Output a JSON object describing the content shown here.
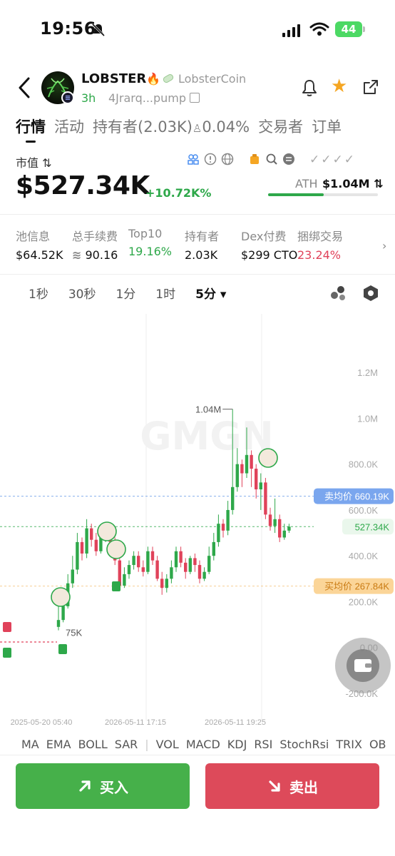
{
  "status_bar": {
    "time": "19:56",
    "battery": "44"
  },
  "token": {
    "name": "LOBSTER",
    "full_name": "LobsterCoin",
    "age": "3h",
    "address": "4Jrarq...pump"
  },
  "tabs": [
    "行情",
    "活动",
    "持有者(2.03K)",
    "0.04%",
    "交易者",
    "订单"
  ],
  "market_cap": {
    "label": "市值 ⇅",
    "value": "$527.34K",
    "change": "+10.72K%",
    "ath_label": "ATH",
    "ath_value": "$1.04M ⇅",
    "ath_progress": 0.507
  },
  "stats": [
    {
      "label": "池信息",
      "value": "$64.52K",
      "tone": "normal"
    },
    {
      "label": "总手续费",
      "value": "90.16",
      "tone": "normal"
    },
    {
      "label": "Top10",
      "value": "19.16%",
      "tone": "green"
    },
    {
      "label": "持有者",
      "value": "2.03K",
      "tone": "normal"
    },
    {
      "label": "Dex付费",
      "value": "$299 CTO",
      "tone": "normal"
    },
    {
      "label": "捆绑交易",
      "value": "23.24%",
      "tone": "red"
    }
  ],
  "intervals": [
    "1秒",
    "30秒",
    "1分",
    "1时",
    "5分 ▾"
  ],
  "chart_data": {
    "type": "candlestick",
    "y_ticks": [
      "1.2M",
      "1.0M",
      "800.0K",
      "600.0K",
      "400.0K",
      "200.0K",
      "0.00",
      "-200.0K"
    ],
    "x_labels": [
      "2025-05-20 05:40",
      "2026-05-11 17:15",
      "2026-05-11 19:25"
    ],
    "ylim": [
      -200000,
      1300000
    ],
    "price_labels": {
      "sell_avg": "卖均价 660.19K",
      "current": "527.34K",
      "buy_avg": "买均价 267.84K",
      "high_annotation": "1.04M",
      "low_annotation": "75K"
    },
    "sell_avg": 660190,
    "current": 527340,
    "buy_avg": 267840,
    "candles": [
      [
        90000,
        120000,
        210000,
        75000
      ],
      [
        120000,
        180000,
        230000,
        110000
      ],
      [
        180000,
        280000,
        320000,
        170000
      ],
      [
        280000,
        340000,
        400000,
        260000
      ],
      [
        340000,
        460000,
        500000,
        320000
      ],
      [
        460000,
        410000,
        480000,
        380000
      ],
      [
        410000,
        520000,
        560000,
        390000
      ],
      [
        520000,
        470000,
        540000,
        440000
      ],
      [
        470000,
        420000,
        500000,
        400000
      ],
      [
        420000,
        480000,
        520000,
        410000
      ],
      [
        480000,
        520000,
        540000,
        460000
      ],
      [
        520000,
        460000,
        530000,
        440000
      ],
      [
        460000,
        380000,
        480000,
        360000
      ],
      [
        380000,
        270000,
        420000,
        250000
      ],
      [
        270000,
        320000,
        350000,
        260000
      ],
      [
        320000,
        360000,
        380000,
        300000
      ],
      [
        360000,
        400000,
        420000,
        340000
      ],
      [
        400000,
        350000,
        420000,
        330000
      ],
      [
        350000,
        330000,
        380000,
        310000
      ],
      [
        330000,
        420000,
        440000,
        320000
      ],
      [
        420000,
        380000,
        440000,
        360000
      ],
      [
        380000,
        300000,
        400000,
        290000
      ],
      [
        300000,
        260000,
        330000,
        230000
      ],
      [
        260000,
        300000,
        320000,
        240000
      ],
      [
        300000,
        350000,
        380000,
        280000
      ],
      [
        350000,
        420000,
        440000,
        330000
      ],
      [
        420000,
        370000,
        440000,
        350000
      ],
      [
        370000,
        330000,
        390000,
        300000
      ],
      [
        330000,
        390000,
        400000,
        320000
      ],
      [
        390000,
        360000,
        410000,
        330000
      ],
      [
        360000,
        300000,
        380000,
        280000
      ],
      [
        300000,
        330000,
        350000,
        290000
      ],
      [
        330000,
        400000,
        440000,
        320000
      ],
      [
        400000,
        460000,
        500000,
        380000
      ],
      [
        460000,
        540000,
        580000,
        440000
      ],
      [
        540000,
        510000,
        560000,
        480000
      ],
      [
        510000,
        600000,
        640000,
        490000
      ],
      [
        600000,
        700000,
        1040000,
        580000
      ],
      [
        700000,
        800000,
        870000,
        680000
      ],
      [
        800000,
        760000,
        820000,
        700000
      ],
      [
        760000,
        840000,
        960000,
        740000
      ],
      [
        840000,
        780000,
        860000,
        700000
      ],
      [
        780000,
        690000,
        800000,
        650000
      ],
      [
        690000,
        720000,
        760000,
        600000
      ],
      [
        720000,
        580000,
        740000,
        560000
      ],
      [
        580000,
        530000,
        610000,
        510000
      ],
      [
        530000,
        560000,
        650000,
        500000
      ],
      [
        560000,
        480000,
        580000,
        460000
      ],
      [
        480000,
        510000,
        540000,
        470000
      ],
      [
        510000,
        527340,
        540000,
        500000
      ]
    ]
  },
  "indicators": [
    "MA",
    "EMA",
    "BOLL",
    "SAR",
    "VOL",
    "MACD",
    "KDJ",
    "RSI",
    "StochRsi",
    "TRIX",
    "OB"
  ],
  "actions": {
    "buy": "买入",
    "sell": "卖出"
  },
  "colors": {
    "up": "#2ea84a",
    "down": "#e0425a",
    "sell_avg": "#6b9be8",
    "buy_avg": "#f5c37a"
  }
}
